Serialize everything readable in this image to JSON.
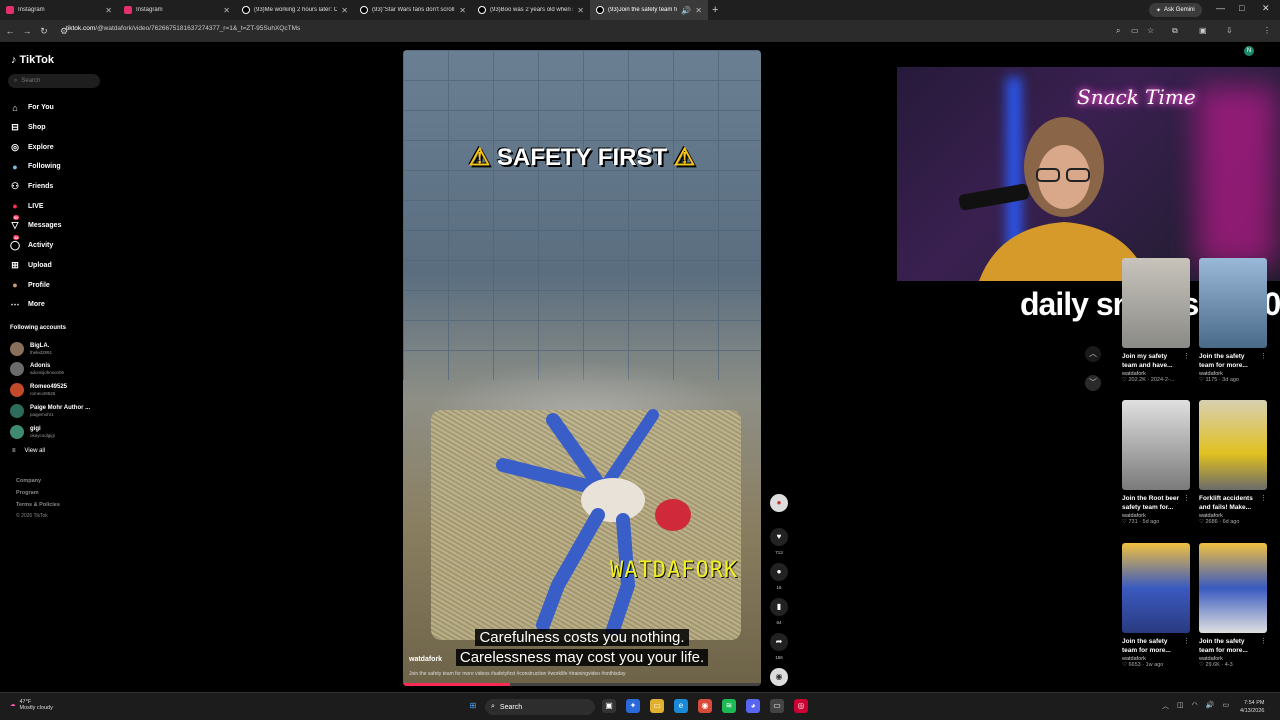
{
  "browser": {
    "tabs": [
      {
        "label": "Instagram",
        "icon": "instagram-icon"
      },
      {
        "label": "Instagram",
        "icon": "instagram-icon"
      },
      {
        "label": "(93)Me working 2 hours later: C",
        "icon": "tiktok-icon"
      },
      {
        "label": "(93)\"Star Wars fans don't scroll",
        "icon": "tiktok-icon"
      },
      {
        "label": "(93)Boo was 2 years old when s",
        "icon": "tiktok-icon"
      },
      {
        "label": "(93)Join the safety team for",
        "icon": "tiktok-icon"
      }
    ],
    "ask_gemini": "Ask Gemini",
    "url_host": "tiktok.com",
    "url_path": "/@watdafork/video/7626675181637274377_r=1&_t=ZT-95SuhXQcTMs",
    "profile_initial": "N"
  },
  "sidebar": {
    "logo": "TikTok",
    "search_placeholder": "Search",
    "menu": [
      {
        "label": "For You",
        "icon": "home-icon"
      },
      {
        "label": "Shop",
        "icon": "shop-icon"
      },
      {
        "label": "Explore",
        "icon": "compass-icon"
      },
      {
        "label": "Following",
        "icon": "following-icon"
      },
      {
        "label": "Friends",
        "icon": "friends-icon"
      },
      {
        "label": "LIVE",
        "icon": "live-icon"
      },
      {
        "label": "Messages",
        "icon": "messages-icon",
        "badge": "50"
      },
      {
        "label": "Activity",
        "icon": "activity-icon",
        "badge": "48"
      },
      {
        "label": "Upload",
        "icon": "upload-icon"
      },
      {
        "label": "Profile",
        "icon": "profile-icon"
      },
      {
        "label": "More",
        "icon": "more-icon"
      }
    ],
    "following_title": "Following accounts",
    "accounts": [
      {
        "name": "BigLA.",
        "handle": "thekid2891"
      },
      {
        "name": "Adonis",
        "handle": "adonisjohnson06"
      },
      {
        "name": "Romeo49525",
        "handle": "romeo49525"
      },
      {
        "name": "Paige Mohr Author ...",
        "handle": "paigemohr1"
      },
      {
        "name": "gigi",
        "handle": "okaycoolgigi"
      }
    ],
    "view_all": "View all",
    "footer": [
      "Company",
      "Program",
      "Terms & Policies",
      "© 2026 TikTok"
    ]
  },
  "video": {
    "overlay_title": "SAFETY FIRST",
    "watermark": "WATDAFORK",
    "caption_line1": "Carefulness costs you nothing.",
    "caption_line2": "Carelessness may cost you your life.",
    "username": "watdafork",
    "description": "Join the safety team for more videos #safetyfirst #construction #worklife #trainingvideo #onthisday",
    "progress": 0.3
  },
  "actions": {
    "likes": "713",
    "comments": "16",
    "saves": "64",
    "shares": "156"
  },
  "stream_overlay": {
    "neon_sign": "Snack Time",
    "banner": "daily snacks 1 / 10"
  },
  "recommended": [
    {
      "title": "Join my safety team and have...",
      "author": "watdafork",
      "stats": "♡ 202.2K · 2024-2-..."
    },
    {
      "title": "Join the safety team for more...",
      "author": "watdafork",
      "stats": "♡ 1175 · 3d ago"
    },
    {
      "title": "Join the Root beer safety team for...",
      "author": "watdafork",
      "stats": "♡ 731 · 5d ago"
    },
    {
      "title": "Forklift accidents and fails! Make...",
      "author": "watdafork",
      "stats": "♡ 2686 · 6d ago"
    },
    {
      "title": "Join the safety team for more...",
      "author": "watdafork",
      "stats": "♡ 6653 · 1w ago"
    },
    {
      "title": "Join the safety team for more...",
      "author": "watdafork",
      "stats": "♡ 29.6K · 4-3"
    }
  ],
  "taskbar": {
    "weather_temp": "47°F",
    "weather_desc": "Mostly cloudy",
    "search": "Search",
    "time": "7:54 PM",
    "date": "4/13/2026"
  }
}
